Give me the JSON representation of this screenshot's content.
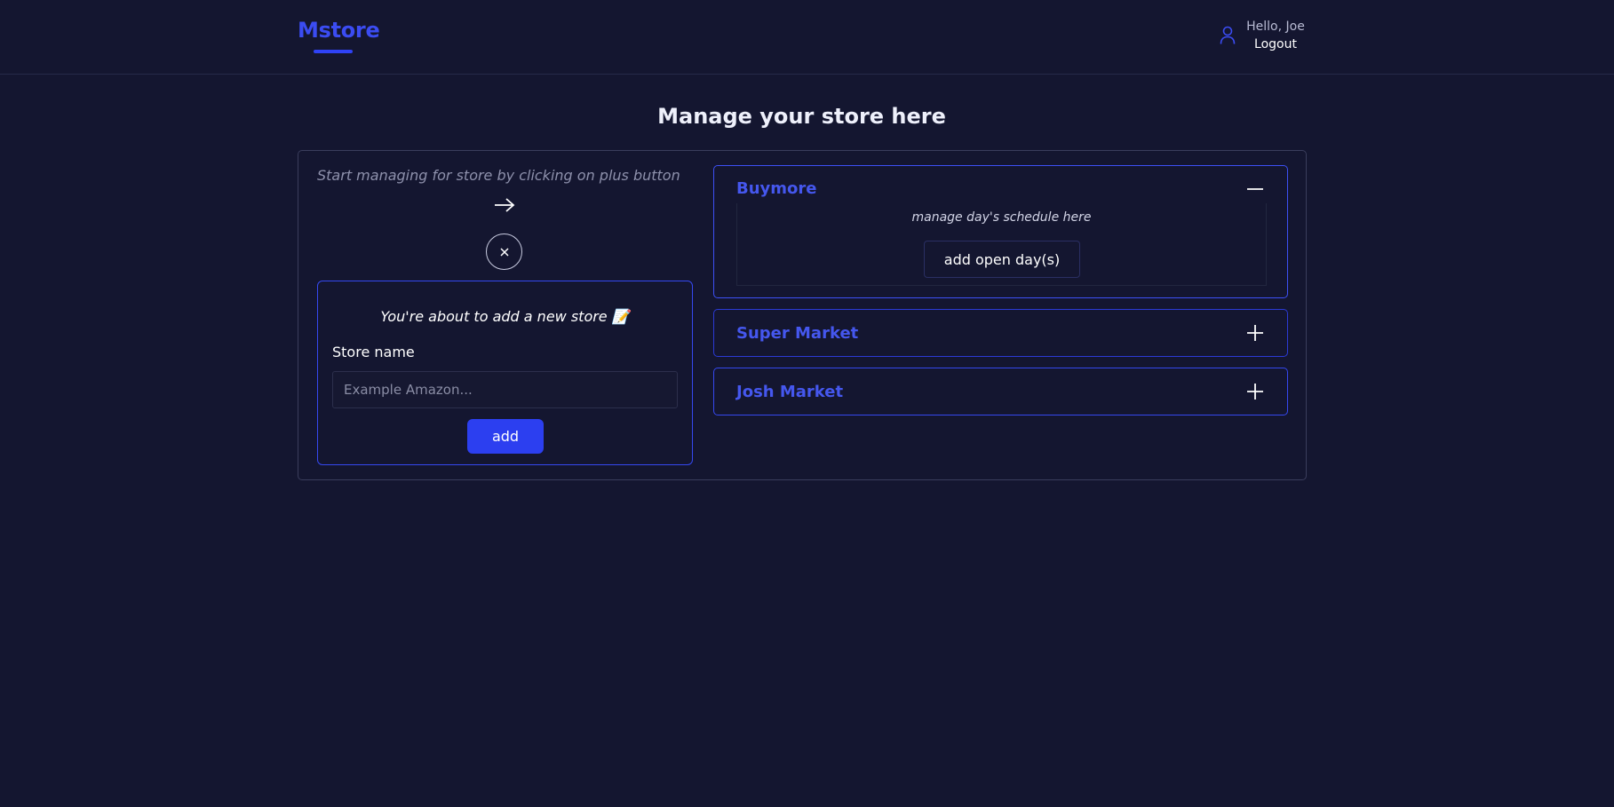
{
  "header": {
    "logo": "Mstore",
    "greeting": "Hello, Joe",
    "logout": "Logout"
  },
  "page": {
    "title": "Manage your store here"
  },
  "left_panel": {
    "hint": "Start managing for store by clicking on plus button",
    "form": {
      "title": "You're about to add a new store 📝",
      "label": "Store name",
      "placeholder": "Example Amazon...",
      "value": "",
      "button": "add"
    }
  },
  "stores": [
    {
      "name": "Buymore",
      "expanded": true,
      "schedule_text": "manage day's schedule here",
      "button": "add open day(s)"
    },
    {
      "name": "Super Market",
      "expanded": false
    },
    {
      "name": "Josh Market",
      "expanded": false
    }
  ],
  "colors": {
    "background": "#141630",
    "accent": "#3b4cf2",
    "button": "#2c3ff0"
  },
  "icons": {
    "user": "user-icon",
    "arrow": "arrow-right-icon",
    "close": "close-icon",
    "minus": "minus-icon",
    "plus": "plus-icon"
  }
}
